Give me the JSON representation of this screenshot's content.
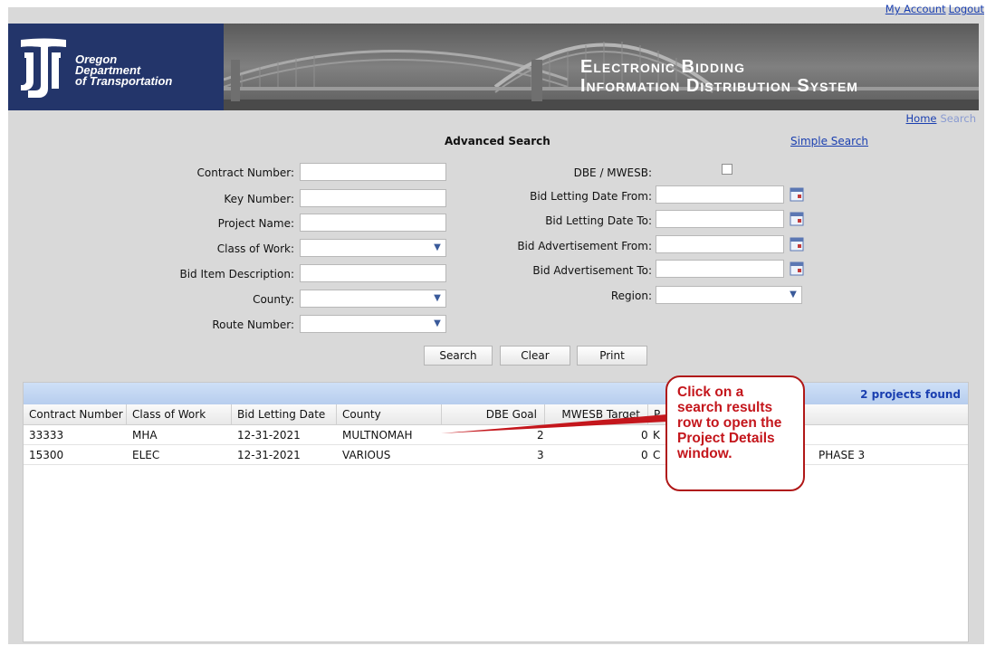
{
  "top_links": {
    "my_account": "My Account",
    "logout": "Logout"
  },
  "banner": {
    "agency": [
      "Oregon",
      "Department",
      "of Transportation"
    ],
    "system_title": [
      "Electronic Bidding",
      "Information Distribution System"
    ]
  },
  "nav": {
    "home": "Home",
    "search": "Search"
  },
  "advanced_search": {
    "title": "Advanced Search",
    "simple_search_link": "Simple Search"
  },
  "left_fields": {
    "contract_number": {
      "label": "Contract Number:",
      "value": ""
    },
    "key_number": {
      "label": "Key Number:",
      "value": ""
    },
    "project_name": {
      "label": "Project Name:",
      "value": ""
    },
    "class_of_work": {
      "label": "Class of Work:",
      "value": ""
    },
    "bid_item_description": {
      "label": "Bid Item Description:",
      "value": ""
    },
    "county": {
      "label": "County:",
      "value": ""
    },
    "route_number": {
      "label": "Route Number:",
      "value": ""
    }
  },
  "right_fields": {
    "dbe_mwesb": {
      "label": "DBE / MWESB:",
      "checked": false
    },
    "bid_letting_from": {
      "label": "Bid Letting Date From:",
      "value": ""
    },
    "bid_letting_to": {
      "label": "Bid Letting Date To:",
      "value": ""
    },
    "bid_adv_from": {
      "label": "Bid Advertisement From:",
      "value": ""
    },
    "bid_adv_to": {
      "label": "Bid Advertisement To:",
      "value": ""
    },
    "region": {
      "label": "Region:",
      "value": ""
    }
  },
  "buttons": {
    "search": "Search",
    "clear": "Clear",
    "print": "Print"
  },
  "results": {
    "found_text": "2 projects found",
    "columns": [
      "Contract Number",
      "Class of Work",
      "Bid Letting Date",
      "County",
      "DBE Goal",
      "MWESB Target",
      "P"
    ],
    "rows": [
      [
        "33333",
        "MHA",
        "12-31-2021",
        "MULTNOMAH",
        "2",
        "0",
        "K"
      ],
      [
        "15300",
        "ELEC",
        "12-31-2021",
        "VARIOUS",
        "3",
        "0",
        "C"
      ]
    ],
    "row2_extra": "PHASE 3"
  },
  "callout": {
    "lines": [
      "Click on a",
      "search results",
      "row to open the",
      "Project Details",
      "window."
    ]
  },
  "colors": {
    "logo_bg": "#23356a",
    "link": "#1a3fb0",
    "callout": "#c4161c",
    "results_header": "#b7cdee"
  }
}
